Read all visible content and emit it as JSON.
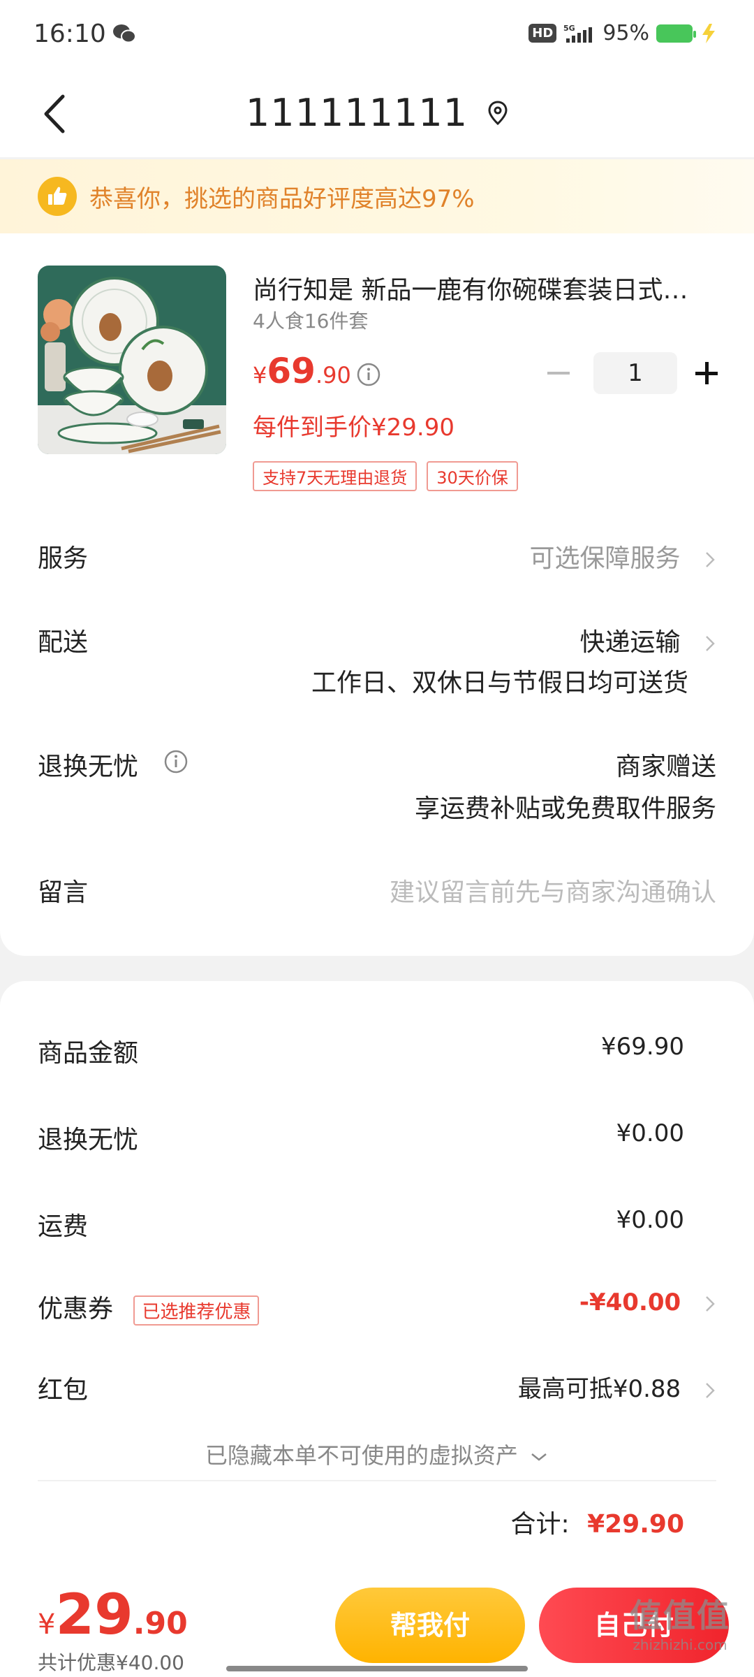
{
  "status_bar": {
    "time": "16:10",
    "network": "5G",
    "battery": "95%",
    "hd": "HD"
  },
  "nav": {
    "title": "111111111"
  },
  "banner": {
    "text": "恭喜你，挑选的商品好评度高达97%"
  },
  "product": {
    "title": "尚行知是 新品一鹿有你碗碟套装日式餐具家用陶瓷",
    "spec": "4人食16件套",
    "price_currency": "¥",
    "price_int": "69",
    "price_dec": ".90",
    "quantity": "1",
    "unit_price": "每件到手价¥29.90",
    "tags": [
      "支持7天无理由退货",
      "30天价保"
    ]
  },
  "rows": {
    "service_label": "服务",
    "service_value": "可选保障服务",
    "delivery_label": "配送",
    "delivery_value": "快递运输",
    "delivery_sub": "工作日、双休日与节假日均可送货",
    "return_label": "退换无忧",
    "return_value": "商家赠送",
    "return_sub": "享运费补贴或免费取件服务",
    "message_label": "留言",
    "message_placeholder": "建议留言前先与商家沟通确认"
  },
  "summary": {
    "goods_label": "商品金额",
    "goods_value": "¥69.90",
    "return_label": "退换无忧",
    "return_value": "¥0.00",
    "shipping_label": "运费",
    "shipping_value": "¥0.00",
    "coupon_label": "优惠券",
    "coupon_tag": "已选推荐优惠",
    "coupon_value": "-¥40.00",
    "redpack_label": "红包",
    "redpack_value": "最高可抵¥0.88",
    "hidden_assets": "已隐藏本单不可使用的虚拟资产",
    "total_label": "合计:",
    "total_value": "¥29.90"
  },
  "bottom": {
    "currency": "¥",
    "price_int": "29",
    "price_dec": ".90",
    "saving": "共计优惠¥40.00",
    "help_pay": "帮我付",
    "self_pay": "自己付"
  },
  "watermark": {
    "big": "值值值",
    "small": "zhizhizhi.com"
  },
  "colors": {
    "accent_red": "#e8392e",
    "yellow": "#ffb300",
    "banner_text": "#e0822a"
  }
}
